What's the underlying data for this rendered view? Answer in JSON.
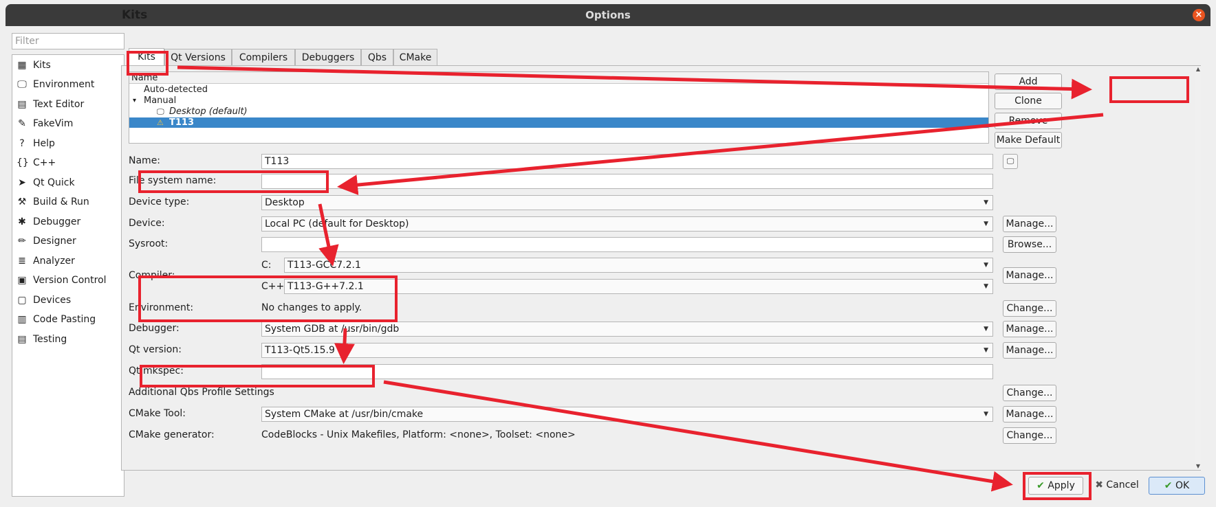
{
  "window": {
    "title": "Options",
    "close_glyph": "×"
  },
  "sidebar": {
    "filter_placeholder": "Filter",
    "items": [
      {
        "label": "Kits",
        "icon": "kits-icon",
        "glyph": "▦"
      },
      {
        "label": "Environment",
        "icon": "monitor-icon",
        "glyph": "🖵"
      },
      {
        "label": "Text Editor",
        "icon": "text-editor-icon",
        "glyph": "▤"
      },
      {
        "label": "FakeVim",
        "icon": "fakevim-icon",
        "glyph": "✎"
      },
      {
        "label": "Help",
        "icon": "help-icon",
        "glyph": "?"
      },
      {
        "label": "C++",
        "icon": "cpp-icon",
        "glyph": "{}"
      },
      {
        "label": "Qt Quick",
        "icon": "qt-quick-icon",
        "glyph": "➤"
      },
      {
        "label": "Build & Run",
        "icon": "hammer-icon",
        "glyph": "⚒"
      },
      {
        "label": "Debugger",
        "icon": "bug-icon",
        "glyph": "✱"
      },
      {
        "label": "Designer",
        "icon": "pencil-icon",
        "glyph": "✏"
      },
      {
        "label": "Analyzer",
        "icon": "analyzer-icon",
        "glyph": "≣"
      },
      {
        "label": "Version Control",
        "icon": "version-control-icon",
        "glyph": "▣"
      },
      {
        "label": "Devices",
        "icon": "devices-icon",
        "glyph": "▢"
      },
      {
        "label": "Code Pasting",
        "icon": "code-pasting-icon",
        "glyph": "▥"
      },
      {
        "label": "Testing",
        "icon": "testing-icon",
        "glyph": "▤"
      }
    ]
  },
  "page": {
    "heading": "Kits"
  },
  "tabs": [
    "Kits",
    "Qt Versions",
    "Compilers",
    "Debuggers",
    "Qbs",
    "CMake"
  ],
  "tree": {
    "header": "Name",
    "rows": [
      {
        "label": "Auto-detected"
      },
      {
        "label": "Manual",
        "expander": "▾"
      },
      {
        "label": "Desktop (default)",
        "icon_glyph": "🖵"
      },
      {
        "label": "T113",
        "icon_glyph": "⚠"
      }
    ]
  },
  "kit_buttons": {
    "add": "Add",
    "clone": "Clone",
    "remove": "Remove",
    "make_default": "Make Default"
  },
  "form": {
    "name_label": "Name:",
    "name_value": "T113",
    "fs_name_label": "File system name:",
    "fs_name_value": "",
    "device_type_label": "Device type:",
    "device_type_value": "Desktop",
    "device_label": "Device:",
    "device_value": "Local PC (default for Desktop)",
    "sysroot_label": "Sysroot:",
    "sysroot_value": "",
    "compiler_label": "Compiler:",
    "compiler_c_label": "C:",
    "compiler_c_value": "T113-GCC7.2.1",
    "compiler_cpp_label": "C++:",
    "compiler_cpp_value": "T113-G++7.2.1",
    "environment_label": "Environment:",
    "environment_value": "No changes to apply.",
    "debugger_label": "Debugger:",
    "debugger_value": "System GDB at /usr/bin/gdb",
    "qt_version_label": "Qt version:",
    "qt_version_value": "T113-Qt5.15.9",
    "qt_mkspec_label": "Qt mkspec:",
    "qt_mkspec_value": "",
    "qbs_label": "Additional Qbs Profile Settings",
    "cmake_tool_label": "CMake Tool:",
    "cmake_tool_value": "System CMake at /usr/bin/cmake",
    "cmake_gen_label": "CMake generator:",
    "cmake_gen_value": "CodeBlocks - Unix Makefiles, Platform: <none>, Toolset: <none>",
    "manage": "Manage...",
    "browse": "Browse...",
    "change": "Change...",
    "combo_arrow": "▼"
  },
  "dialog_buttons": {
    "apply": "Apply",
    "apply_glyph": "✔",
    "cancel": "Cancel",
    "cancel_glyph": "✖",
    "ok": "OK",
    "ok_glyph": "✔"
  },
  "colors": {
    "annotation_red": "#e8222e",
    "selection_blue": "#3a87c9",
    "titlebar": "#3a3a3a"
  }
}
